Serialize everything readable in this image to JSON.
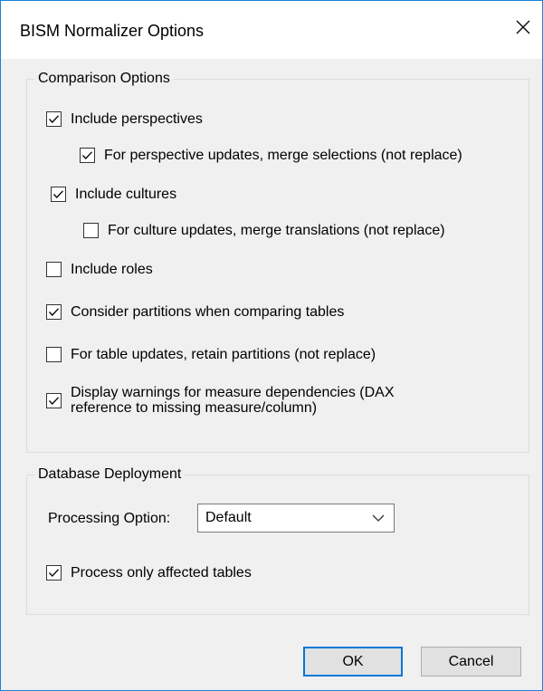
{
  "window": {
    "title": "BISM Normalizer Options"
  },
  "comparison": {
    "legend": "Comparison Options",
    "options": [
      {
        "label": "Include perspectives",
        "checked": true
      },
      {
        "label": "For perspective updates, merge selections (not replace)",
        "checked": true
      },
      {
        "label": "Include cultures",
        "checked": true
      },
      {
        "label": "For culture updates, merge translations (not replace)",
        "checked": false
      },
      {
        "label": "Include roles",
        "checked": false
      },
      {
        "label": "Consider partitions when comparing tables",
        "checked": true
      },
      {
        "label": "For table updates, retain partitions (not replace)",
        "checked": false
      },
      {
        "label": "Display warnings for measure dependencies (DAX reference to missing measure/column)",
        "checked": true
      }
    ]
  },
  "deployment": {
    "legend": "Database Deployment",
    "processing_label": "Processing Option:",
    "processing_value": "Default",
    "process_affected": {
      "label": "Process only affected tables",
      "checked": true
    }
  },
  "buttons": {
    "ok": "OK",
    "cancel": "Cancel"
  },
  "icons": {
    "close": "close-icon",
    "check": "check-icon",
    "dropdown": "chevron-down-icon"
  },
  "colors": {
    "accent": "#0078d7",
    "window_border": "#1883d7",
    "dialog_bg": "#f0f0f0"
  }
}
